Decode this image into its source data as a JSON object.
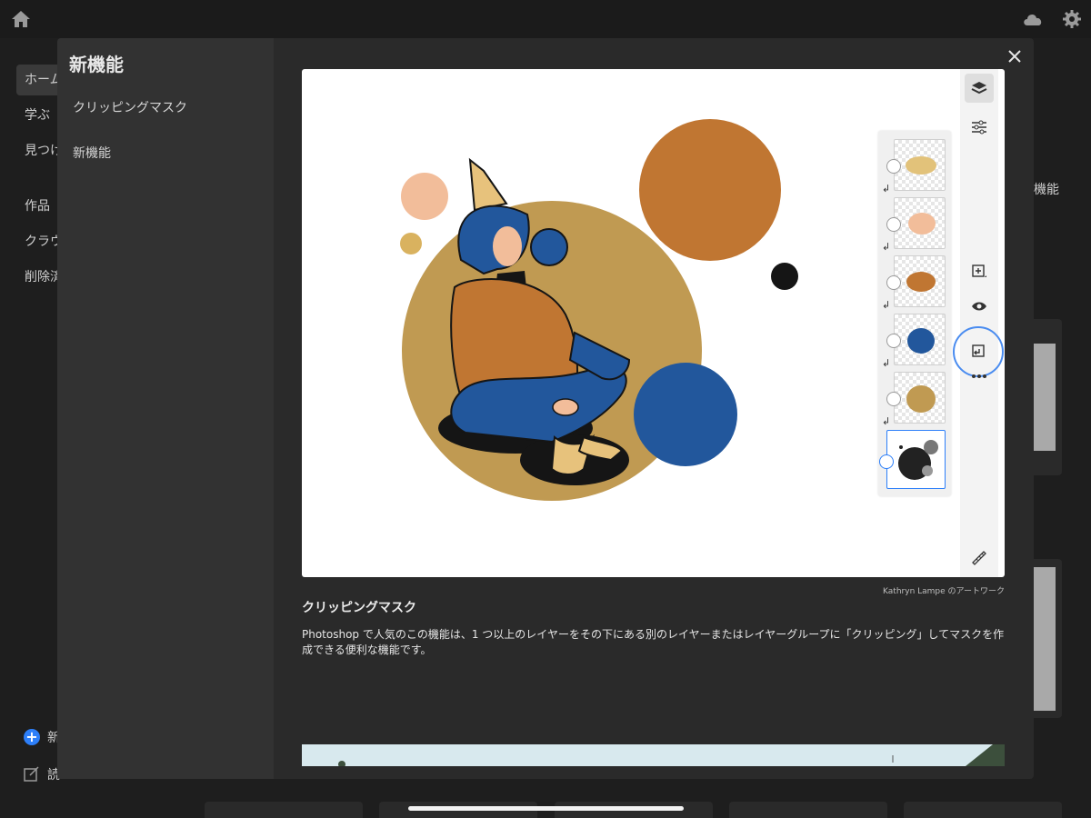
{
  "colors": {
    "accent": "#2d7ff9",
    "mustard": "#c09a52",
    "orange": "#c07632",
    "peach": "#f2bd9a",
    "blue": "#22579c",
    "black": "#151515"
  },
  "topbar": {
    "home_icon": "home-icon",
    "cloud_icon": "cloud-icon",
    "settings_icon": "gear-icon"
  },
  "sidebar": {
    "items": [
      {
        "label": "ホーム",
        "active": true
      },
      {
        "label": "学ぶ"
      },
      {
        "label": "見つける"
      },
      {
        "label": "作品"
      },
      {
        "label": "クラウド"
      },
      {
        "label": "削除済み"
      }
    ],
    "new_label": "新",
    "read_label": "読"
  },
  "background": {
    "right_label": "機能"
  },
  "modal": {
    "title": "新機能",
    "links": [
      "クリッピングマスク",
      "新機能"
    ],
    "close_icon": "close-icon",
    "credit": "Kathryn Lampe のアートワーク",
    "feature_title": "クリッピングマスク",
    "feature_desc": "Photoshop で人気のこの機能は、1 つ以上のレイヤーをその下にある別のレイヤーまたはレイヤーグループに「クリッピング」してマスクを作成できる便利な機能です。"
  },
  "layer_panel": {
    "layers": [
      "mustard-blob",
      "peach-blob",
      "orange-blob",
      "blue-blob",
      "tan-blob",
      "base-layer"
    ],
    "selected_index": 5
  },
  "tool_rail": [
    "layers-icon",
    "adjustments-icon",
    "add-layer-icon",
    "visibility-eye-icon",
    "clipping-mask-icon",
    "more-icon",
    "ruler-icon"
  ]
}
